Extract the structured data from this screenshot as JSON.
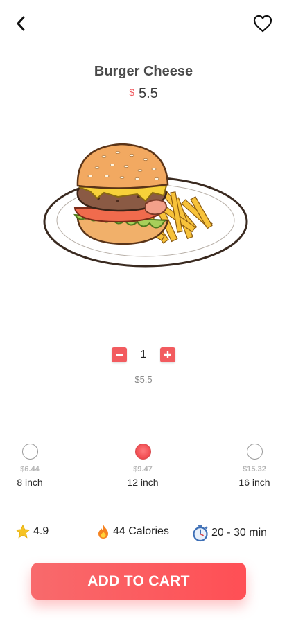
{
  "product": {
    "name": "Burger Cheese",
    "currency_symbol": "$",
    "price": "5.5"
  },
  "quantity": {
    "value": "1",
    "subtotal": "$5.5"
  },
  "sizes": [
    {
      "price": "$6.44",
      "label": "8 inch",
      "selected": false
    },
    {
      "price": "$9.47",
      "label": "12 inch",
      "selected": true
    },
    {
      "price": "$15.32",
      "label": "16 inch",
      "selected": false
    }
  ],
  "stats": {
    "rating": "4.9",
    "calories": "44 Calories",
    "time": "20 - 30 min"
  },
  "actions": {
    "add_to_cart": "ADD TO CART"
  },
  "icons": {
    "back": "chevron-left-icon",
    "favorite": "heart-icon",
    "decrease": "minus-icon",
    "increase": "plus-icon",
    "rating": "star-icon",
    "calories": "fire-icon",
    "time": "stopwatch-icon"
  },
  "colors": {
    "accent": "#f25b5f",
    "currency": "#f0545a",
    "star": "#f6c324"
  }
}
